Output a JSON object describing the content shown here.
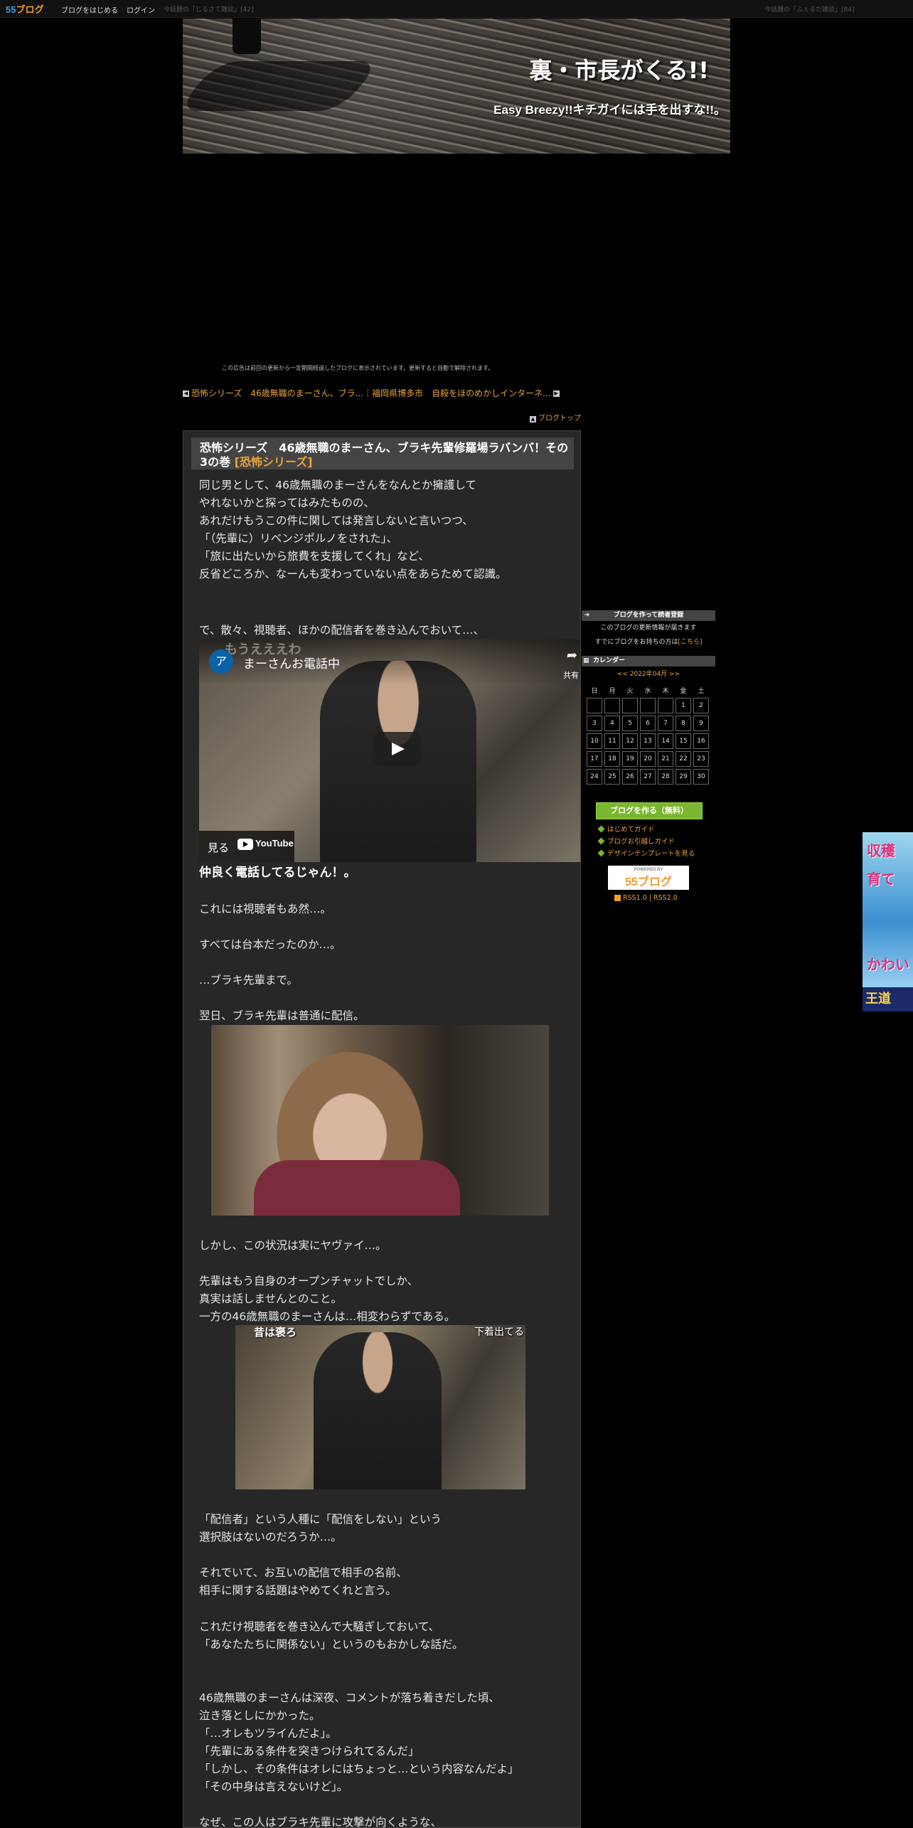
{
  "topbar": {
    "logo_a": "55",
    "logo_b": "ブログ",
    "start_blog": "ブログをはじめる",
    "login": "ログイン",
    "dim_left": "今話題の「じるさて雑談」[42]",
    "dim_right": "今話題の「ふぇるた雑談」[84]"
  },
  "header": {
    "title": "裏・市長がくる!!",
    "subtitle": "Easy Breezy!!キチガイには手を出すな!!。"
  },
  "ad_notice": "この広告は前回の更新から一定期間経過したブログに表示されています。更新すると自動で解除されます。",
  "nav": {
    "prev_next": "恐怖シリーズ　46歳無職のまーさん、ブラ...｜福岡県博多市　自殺をほのめかしインターネ...",
    "blog_top": "ブログトップ"
  },
  "article": {
    "title": "恐怖シリーズ　46歳無職のまーさん、ブラキ先輩修羅場ラバンバ！その3の巻",
    "category": "[恐怖シリーズ]",
    "p1": "同じ男として、46歳無職のまーさんをなんとか擁護して\nやれないかと探ってはみたものの、\nあれだけもうこの件に関しては発言しないと言いつつ、\n「（先輩に）リベンジポルノをされた」、\n「旅に出たいから旅費を支援してくれ」など、\n反省どころか、なーんも変わっていない点をあらためて認識。",
    "p2": "で、散々、視聴者、ほかの配信者を巻き込んでおいて…、",
    "video": {
      "avatar": "ア",
      "title": "まーさんお電話中",
      "share": "共有",
      "watch": "見る",
      "yt": "YouTube",
      "overlay": "もうえええわ"
    },
    "p3": "仲良く電話してるじゃん！。",
    "p4": "これには視聴者もあ然…。",
    "p5": "すべては台本だったのか…。",
    "p6": "…ブラキ先輩まで。",
    "p7": "翌日、ブラキ先輩は普通に配信。",
    "p8": "しかし、この状況は実にヤヴァイ…。",
    "p9": "先輩はもう自身のオープンチャットでしか、\n真実は話しませんとのこと。\n一方の46歳無職のまーさんは…相変わらずである。",
    "img2": {
      "cap_left": "昔は褒ろ",
      "cap_right": "下着出てる"
    },
    "p10": "「配信者」という人種に「配信をしない」という\n選択肢はないのだろうか…。",
    "p11": "それでいて、お互いの配信で相手の名前、\n相手に関する話題はやめてくれと言う。",
    "p12": "これだけ視聴者を巻き込んで大騒ぎしておいて、\n「あなたたちに関係ない」というのもおかしな話だ。",
    "p13": "46歳無職のまーさんは深夜、コメントが落ち着きだした頃、\n泣き落としにかかった。\n「…オレもツライんだよ」。\n「先輩にある条件を突きつけられてるんだ」\n「しかし、その条件はオレにはちょっと…という内容なんだよ」\n「その中身は言えないけど」。",
    "p14": "なぜ、この人はブラキ先輩に攻撃が向くような、"
  },
  "sidebar": {
    "reader_head": "ブログを作って読者登録",
    "reader_text1": "このブログの更新情報が届きます",
    "reader_text2": "すでにブログをお持ちの方は",
    "reader_link": "[こちら]",
    "calendar_head": "カレンダー",
    "calendar_month": "<< 2022年04月 >>",
    "weekdays": [
      "日",
      "月",
      "火",
      "水",
      "木",
      "金",
      "土"
    ],
    "weeks": [
      [
        "",
        "",
        "",
        "",
        "",
        "1",
        "2"
      ],
      [
        "3",
        "4",
        "5",
        "6",
        "7",
        "8",
        "9"
      ],
      [
        "10",
        "11",
        "12",
        "13",
        "14",
        "15",
        "16"
      ],
      [
        "17",
        "18",
        "19",
        "20",
        "21",
        "22",
        "23"
      ],
      [
        "24",
        "25",
        "26",
        "27",
        "28",
        "29",
        "30"
      ]
    ],
    "create_button": "ブログを作る（無料）",
    "guide": [
      "はじめてガイド",
      "ブログお引越しガイド",
      "デザインテンプレートを見る"
    ],
    "powered_small": "POWERED BY",
    "powered_logo": "55ブログ",
    "rss": "RSS1.0 | RSS2.0"
  },
  "side_ad": {
    "line1": "収穫",
    "line2": "育て",
    "line3": "かわい",
    "bottom": "王道"
  }
}
